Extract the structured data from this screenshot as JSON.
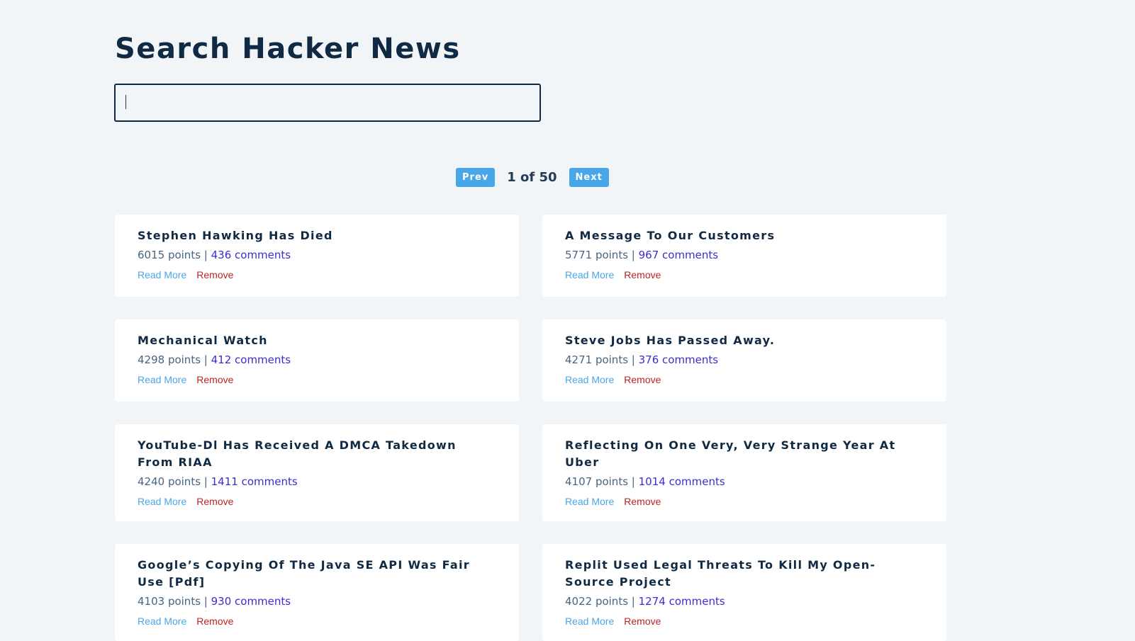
{
  "header": {
    "title": "Search Hacker News"
  },
  "search": {
    "value": "",
    "placeholder": ""
  },
  "pagination": {
    "prev_label": "Prev",
    "next_label": "Next",
    "current_page": 1,
    "total_pages": 50,
    "info": "1 of 50"
  },
  "story_actions": {
    "read_more_label": "Read More",
    "remove_label": "Remove"
  },
  "stories": [
    {
      "title": "Stephen Hawking Has Died",
      "points_text": "6015 points |",
      "comments_text": "436 comments",
      "points": 6015,
      "comments": 436
    },
    {
      "title": "A Message To Our Customers",
      "points_text": "5771 points |",
      "comments_text": "967 comments",
      "points": 5771,
      "comments": 967
    },
    {
      "title": "Mechanical Watch",
      "points_text": "4298 points |",
      "comments_text": "412 comments",
      "points": 4298,
      "comments": 412
    },
    {
      "title": "Steve Jobs Has Passed Away.",
      "points_text": "4271 points |",
      "comments_text": "376 comments",
      "points": 4271,
      "comments": 376
    },
    {
      "title": "YouTube-Dl Has Received A DMCA Takedown From RIAA",
      "points_text": "4240 points |",
      "comments_text": "1411 comments",
      "points": 4240,
      "comments": 1411
    },
    {
      "title": "Reflecting On One Very, Very Strange Year At Uber",
      "points_text": "4107 points |",
      "comments_text": "1014 comments",
      "points": 4107,
      "comments": 1014
    },
    {
      "title": "Google’s Copying Of The Java SE API Was Fair Use [Pdf]",
      "points_text": "4103 points |",
      "comments_text": "930 comments",
      "points": 4103,
      "comments": 930
    },
    {
      "title": "Replit Used Legal Threats To Kill My Open-Source Project",
      "points_text": "4022 points |",
      "comments_text": "1274 comments",
      "points": 4022,
      "comments": 1274
    }
  ],
  "colors": {
    "background": "#f1f5f8",
    "title_text": "#102a43",
    "button_blue": "#49a6e9",
    "comments_link": "#3a2ecf",
    "remove_red": "#bb2525",
    "card": "#ffffff"
  }
}
